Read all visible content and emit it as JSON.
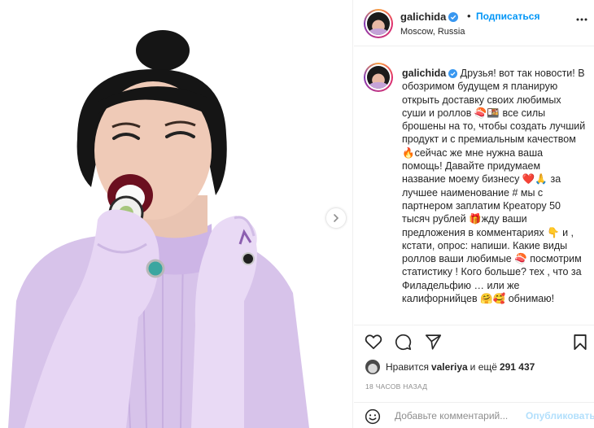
{
  "post": {
    "username": "galichida",
    "follow_label": "Подписаться",
    "dot": "•",
    "location": "Moscow, Russia",
    "caption": "Друзья! вот так новости! В обозримом будущем я планирую открыть доставку своих любимых суши и роллов 🍣🍱 все силы брошены на то, чтобы создать лучший продукт и с премиальным качеством 🔥сейчас же мне нужна ваша помощь! Давайте придумаем название моему бизнесу ❤️🙏 за лучшее наименование # мы с партнером заплатим Креатору 50 тысяч рублей 🎁жду ваши предложения в комментариях 👇 и , кстати, опрос: напиши. Какие виды роллов ваши любимые 🍣 посмотрим статистику ! Кого больше? тех , что за Филадельфию … или же калифорнийцев 🤗🥰 обнимаю!",
    "likes_prefix": "Нравится",
    "liked_by": "valeriya",
    "likes_suffix": "и ещё",
    "likes_count": "291 437",
    "timestamp": "18 ЧАСОВ НАЗАД"
  },
  "comment": {
    "placeholder": "Добавьте комментарий...",
    "publish_label": "Опубликовать"
  },
  "icons": {
    "verified": "verified-badge-icon",
    "more": "more-options-icon",
    "like": "heart-icon",
    "comment": "comment-icon",
    "share": "paper-plane-icon",
    "save": "bookmark-icon",
    "emoji": "smile-icon",
    "next": "chevron-right-icon"
  },
  "colors": {
    "accent": "#0095f6",
    "publish_disabled": "#b2dffc",
    "muted": "#8e8e8e",
    "text": "#262626"
  }
}
